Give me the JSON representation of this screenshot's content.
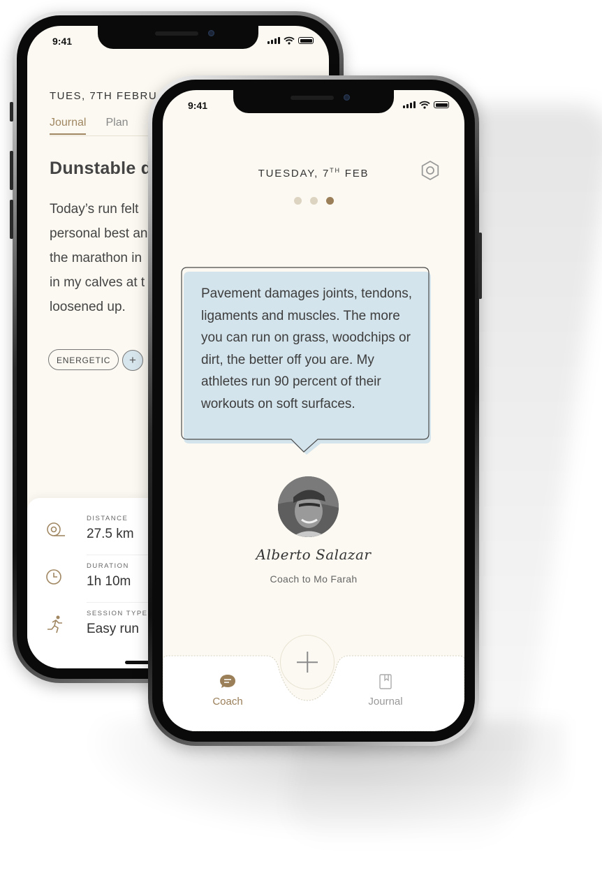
{
  "status_bar": {
    "time": "9:41"
  },
  "journal_screen": {
    "date": "TUES, 7TH FEBRUARY",
    "tabs": [
      {
        "label": "Journal",
        "active": true
      },
      {
        "label": "Plan",
        "active": false
      }
    ],
    "entry_title": "Dunstable do",
    "entry_lines": [
      "Today’s run felt",
      "personal best an",
      "the marathon in",
      "in my calves at t",
      "loosened up."
    ],
    "mood_tag": "ENERGETIC",
    "add_tag_label": "+",
    "stats": [
      {
        "label": "DISTANCE",
        "value": "27.5 km",
        "icon": "distance-icon"
      },
      {
        "label": "DURATION",
        "value": "1h 10m",
        "icon": "clock-icon"
      },
      {
        "label": "SESSION TYPE",
        "value": "Easy run",
        "icon": "runner-icon"
      }
    ]
  },
  "coach_screen": {
    "date_prefix": "TUESDAY, 7",
    "date_sup": "TH",
    "date_suffix": " FEB",
    "pager": {
      "count": 3,
      "active_index": 2
    },
    "quote_lines": [
      "Pavement damages joints, tendons,",
      "ligaments and muscles. The more",
      "you can run on grass, woodchips or",
      "dirt, the better off you are. My",
      "athletes run 90 percent of their",
      "workouts on soft surfaces."
    ],
    "coach_name": "Alberto Salazar",
    "coach_subtitle": "Coach to Mo Farah",
    "tabbar": {
      "coach_label": "Coach",
      "journal_label": "Journal"
    }
  },
  "colors": {
    "accent": "#9b7f59",
    "screen_bg": "#fbf9f1",
    "bubble_bg": "#d4e4ec"
  }
}
